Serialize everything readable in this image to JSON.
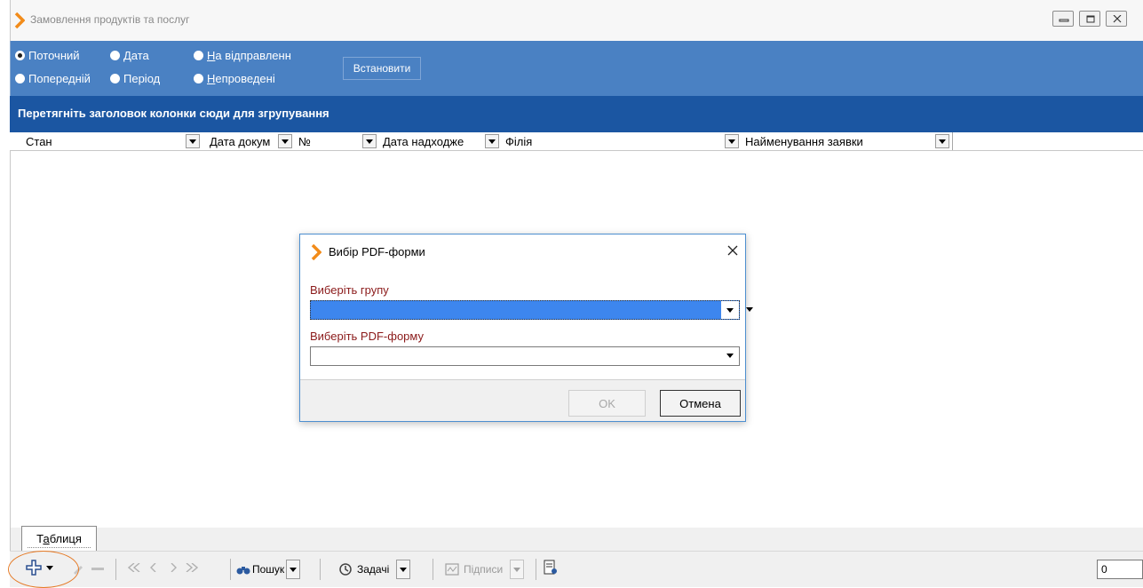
{
  "window": {
    "title": "Замовлення продуктів та послуг",
    "accent_color": "#f28c1a",
    "controls": [
      "minimize-icon",
      "restore-icon",
      "close-icon"
    ]
  },
  "filters": {
    "radios": [
      {
        "label_pre": "",
        "label_u": "",
        "label_post": "Поточний",
        "selected": true
      },
      {
        "label_pre": "",
        "label_u": "",
        "label_post": "Дата",
        "selected": false
      },
      {
        "label_pre": "",
        "label_u": "Н",
        "label_post": "а відправленн",
        "selected": false
      },
      {
        "label_pre": "",
        "label_u": "",
        "label_post": "Попередній",
        "selected": false
      },
      {
        "label_pre": "",
        "label_u": "",
        "label_post": "Період",
        "selected": false
      },
      {
        "label_pre": "",
        "label_u": "Н",
        "label_post": "епроведені",
        "selected": false
      }
    ],
    "apply_label": "Встановити",
    "band_color": "#4a81c3"
  },
  "group_header": "Перетягніть заголовок колонки сюди для згрупування",
  "grid": {
    "columns": [
      "Стан",
      "Дата докум",
      "№",
      "Дата надходже",
      "Філія",
      "Найменування заявки"
    ]
  },
  "tabs": {
    "table_pre": "Т",
    "table_u": "а",
    "table_post": "блиця"
  },
  "toolbar": {
    "search_label": "Пошук",
    "tasks_label": "Задачі",
    "signatures_label": "Підписи",
    "counter_value": "0"
  },
  "dialog": {
    "title": "Вибір PDF-форми",
    "group_label": "Виберіть групу",
    "group_value": "",
    "form_label": "Виберіть PDF-форму",
    "form_value": "",
    "ok_label": "OK",
    "cancel_label": "Отмена"
  }
}
